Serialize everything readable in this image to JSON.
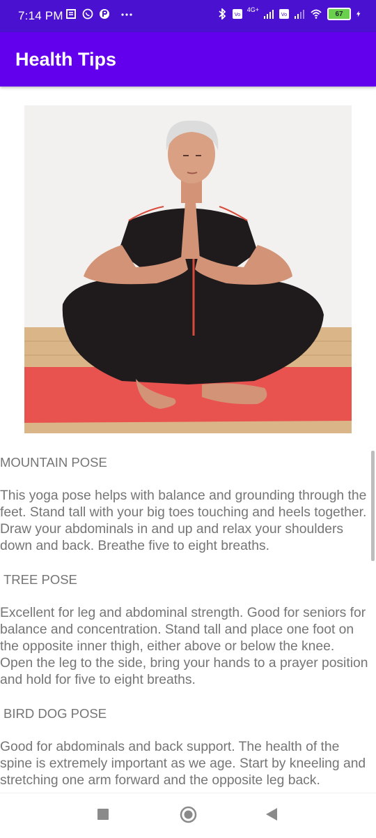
{
  "status_bar": {
    "time": "7:14 PM",
    "battery_level": "67",
    "network": "4G+",
    "icons": [
      "notes-icon",
      "whatsapp-icon",
      "app-notification-icon",
      "more-dots-icon",
      "bluetooth-icon",
      "volte-icon",
      "signal-icon",
      "volte-icon",
      "signal-icon",
      "wifi-icon",
      "battery-icon",
      "charging-icon"
    ]
  },
  "app_bar": {
    "title": "Health Tips"
  },
  "hero_image": {
    "subject": "woman-in-lotus-pose-icon"
  },
  "poses": [
    {
      "title": "MOUNTAIN POSE",
      "body": " This yoga pose helps with balance and grounding through the feet. Stand tall with your big toes touching and heels together. Draw your abdominals in and up and relax your shoulders down and back. Breathe five to eight breaths."
    },
    {
      "title": "TREE POSE",
      "body": " Excellent for leg and abdominal strength. Good for seniors for balance and concentration. Stand tall and place one foot on the opposite inner thigh, either above or below the knee. Open the leg to the side, bring your hands to a prayer position and hold for five to eight breaths."
    },
    {
      "title": "BIRD DOG POSE",
      "body": " Good for abdominals and back support. The health of the spine is extremely important as we age. Start by kneeling and stretching one arm forward and the opposite leg back."
    }
  ],
  "colors": {
    "status_bar": "#4a12d0",
    "app_bar": "#6200ee",
    "text": "#757575",
    "mat": "#e8524f"
  },
  "nav": {
    "recents": "square-recents-icon",
    "home": "circle-home-icon",
    "back": "triangle-back-icon"
  }
}
